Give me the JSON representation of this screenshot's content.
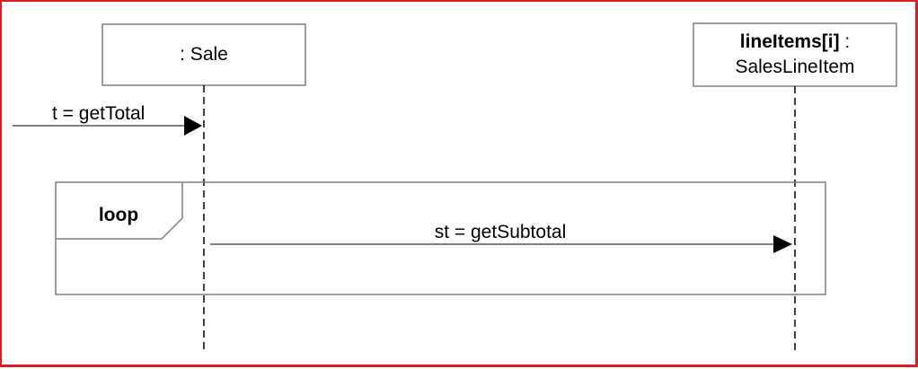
{
  "diagram": {
    "lifelines": [
      {
        "label": ": Sale"
      },
      {
        "label_bold": "lineItems[i]",
        "label_rest": " :",
        "label_line2": "SalesLineItem"
      }
    ],
    "messages": [
      {
        "label": "t = getTotal"
      },
      {
        "label": "st = getSubtotal"
      }
    ],
    "fragment": {
      "operator": "loop"
    }
  },
  "colors": {
    "frame_border": "#d81e1e",
    "line": "#000000",
    "box_border": "#7f7f7f"
  }
}
